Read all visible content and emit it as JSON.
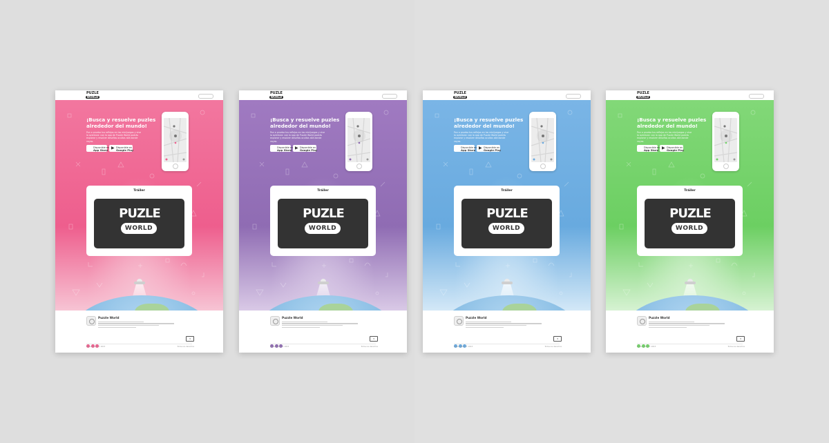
{
  "logo": {
    "line1": "PUZLE",
    "line2": "WORLD"
  },
  "hero": {
    "headline": "¡Busca y resuelve puzles alrededor del mundo!",
    "body": "Pon a prueba tus reflejos en los minijuegos y vive la aventura: con la app de Puzzle World podrás explorar y resolver desafíos ocultos allá donde vayas."
  },
  "stores": {
    "appstore": {
      "top": "Disponible en",
      "name": "App Store"
    },
    "googleplay": {
      "top": "Disponible en",
      "name": "Google Play"
    }
  },
  "trailer": {
    "title": "Tráiler",
    "logo_line1": "PUZLE",
    "logo_line2": "WORLD"
  },
  "footer": {
    "app_name": "Puzzle World",
    "left_small": "Puzzle World © 2015",
    "right_small": "Todos los derechos"
  },
  "variants": [
    {
      "id": "pink",
      "accent": "#ef5f8e",
      "bg_top": "#f2779f",
      "bg_mid": "#ee5e8d",
      "bg_glow": "#f7c4d4"
    },
    {
      "id": "purple",
      "accent": "#8d68b1",
      "bg_top": "#a07ac1",
      "bg_mid": "#8f6cb3",
      "bg_glow": "#d9c9e6"
    },
    {
      "id": "blue",
      "accent": "#67a9e0",
      "bg_top": "#7ab5e6",
      "bg_mid": "#68aadf",
      "bg_glow": "#d3e8f7"
    },
    {
      "id": "green",
      "accent": "#6fd365",
      "bg_top": "#82d878",
      "bg_mid": "#6ccf62",
      "bg_glow": "#d6f2d2"
    }
  ]
}
